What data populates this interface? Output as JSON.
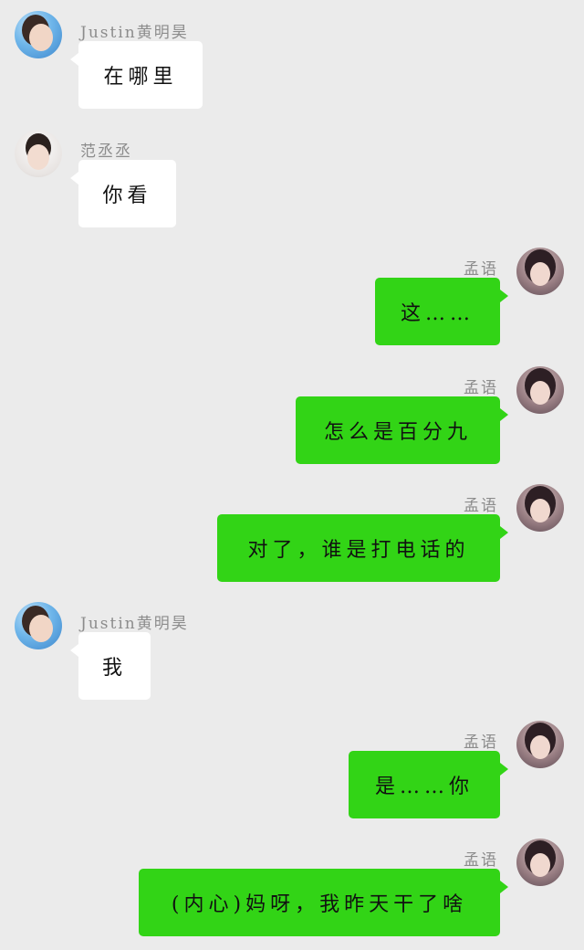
{
  "colors": {
    "background": "#ebebeb",
    "incoming_bubble": "#ffffff",
    "outgoing_bubble": "#32d416",
    "name_text": "#8c8c8c"
  },
  "messages": [
    {
      "side": "left",
      "sender": "Justin黄明昊",
      "avatar": "avatar-justin-icon",
      "text": "在哪里"
    },
    {
      "side": "left",
      "sender": "范丞丞",
      "avatar": "avatar-fan-icon",
      "text": "你看"
    },
    {
      "side": "right",
      "sender": "孟语",
      "avatar": "avatar-meng-icon",
      "text": "这……"
    },
    {
      "side": "right",
      "sender": "孟语",
      "avatar": "avatar-meng-icon",
      "text": "怎么是百分九"
    },
    {
      "side": "right",
      "sender": "孟语",
      "avatar": "avatar-meng-icon",
      "text": "对了，谁是打电话的"
    },
    {
      "side": "left",
      "sender": "Justin黄明昊",
      "avatar": "avatar-justin-icon",
      "text": "我"
    },
    {
      "side": "right",
      "sender": "孟语",
      "avatar": "avatar-meng-icon",
      "text": "是……你"
    },
    {
      "side": "right",
      "sender": "孟语",
      "avatar": "avatar-meng-icon",
      "text": "(内心)妈呀，我昨天干了啥"
    }
  ]
}
